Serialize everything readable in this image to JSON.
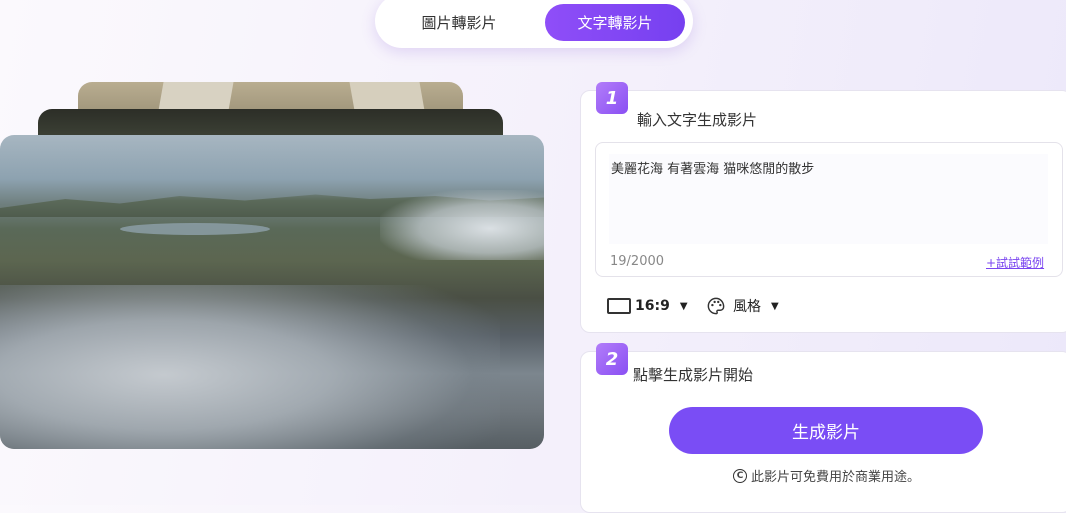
{
  "tabs": {
    "image_to_video": "圖片轉影片",
    "text_to_video": "文字轉影片"
  },
  "step1": {
    "number": "1",
    "title": "輸入文字生成影片",
    "input_value": "美麗花海  有著雲海  猫咪悠閒的散步",
    "char_count": "19/2000",
    "example_link": "+試試範例",
    "aspect_ratio": "16:9",
    "style_label": "風格"
  },
  "step2": {
    "number": "2",
    "title": "點擊生成影片開始",
    "generate_button": "生成影片",
    "note": "此影片可免費用於商業用途。"
  },
  "colors": {
    "accent": "#7a4df5",
    "tab_active": "#8f4ef8",
    "link": "#7a45f0"
  },
  "icons": [
    "aspect-ratio-icon",
    "caret-down-icon",
    "palette-icon",
    "copyright-icon"
  ]
}
